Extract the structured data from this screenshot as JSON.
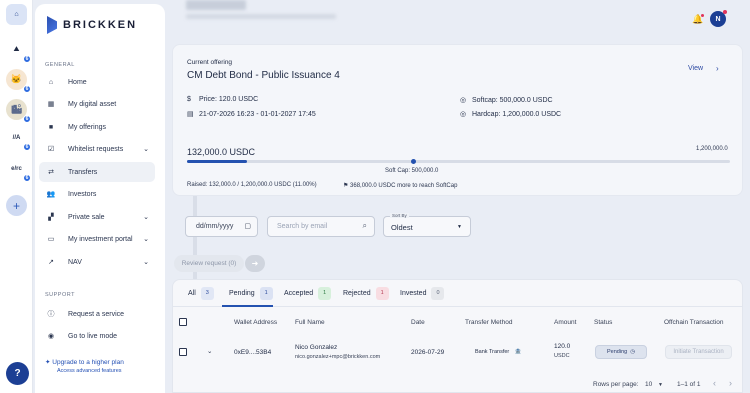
{
  "rail": {
    "home_icon": "home-icon",
    "entities": [
      {
        "glyph": "⯅",
        "badge": "6",
        "color": "#1f2a44",
        "bg": "#ffffff"
      },
      {
        "glyph": "🐱",
        "badge": "6",
        "color": "#b26b2a",
        "bg": "#f6e6d2"
      },
      {
        "glyph": "🏙",
        "badge": "6",
        "color": "#5b6a8c",
        "bg": "#e8e2cf"
      },
      {
        "glyph": "//A",
        "badge": "6",
        "color": "#1f2a44",
        "bg": "#ffffff"
      },
      {
        "glyph": "e/rc",
        "badge": "6",
        "color": "#2b3650",
        "bg": "#ffffff"
      }
    ],
    "add_label": "+",
    "help_label": "?"
  },
  "sidebar": {
    "brand": "BRICKKEN",
    "general_label": "GENERAL",
    "items": [
      {
        "label": "Home",
        "icon": "home-icon",
        "glyph": "⌂",
        "chev": ""
      },
      {
        "label": "My digital asset",
        "icon": "building-icon",
        "glyph": "▦",
        "chev": ""
      },
      {
        "label": "My offerings",
        "icon": "briefcase-icon",
        "glyph": "■",
        "chev": ""
      },
      {
        "label": "Whitelist requests",
        "icon": "checkbox-icon",
        "glyph": "☑",
        "chev": "⌄"
      },
      {
        "label": "Transfers",
        "icon": "transfer-icon",
        "glyph": "⇄",
        "chev": ""
      },
      {
        "label": "Investors",
        "icon": "people-icon",
        "glyph": "👥",
        "chev": ""
      },
      {
        "label": "Private sale",
        "icon": "grid-icon",
        "glyph": "▞",
        "chev": "⌄"
      },
      {
        "label": "My investment portal",
        "icon": "portal-icon",
        "glyph": "▭",
        "chev": "⌄"
      },
      {
        "label": "NAV",
        "icon": "trend-icon",
        "glyph": "↗",
        "chev": "⌄"
      }
    ],
    "support_label": "SUPPORT",
    "support_items": [
      {
        "label": "Request a service",
        "icon": "info-icon",
        "glyph": "ⓘ"
      },
      {
        "label": "Go to live mode",
        "icon": "broadcast-icon",
        "glyph": "◉"
      }
    ],
    "upgrade_title": "Upgrade to a higher plan",
    "upgrade_sub": "Access advanced features"
  },
  "header": {
    "avatar_initial": "N"
  },
  "offering": {
    "current_label": "Current offering",
    "title": "CM Debt Bond - Public Issuance 4",
    "view_label": "View",
    "price": "Price: 120.0 USDC",
    "dates": "21-07-2026 16:23 - 01-01-2027 17:45",
    "softcap": "Softcap: 500,000.0 USDC",
    "hardcap": "Hardcap: 1,200,000.0 USDC",
    "amount_raised": "132,000.0 USDC",
    "hardcap_short": "1,200,000.0",
    "softcap_marker": "Soft Cap: 500,000.0",
    "raised_text": "Raised:  132,000.0 / 1,200,000.0 USDC (11.00%)",
    "more_text": "368,000.0 USDC more to reach SoftCap",
    "progress_fraction": 0.11,
    "softcap_fraction": 0.4167
  },
  "filters": {
    "date_placeholder": "dd/mm/yyyy",
    "search_placeholder": "Search by email",
    "sort_caption": "Sort By",
    "sort_value": "Oldest",
    "review_label": "Review request (0)",
    "review_go": "➜"
  },
  "tabs": [
    {
      "label": "All",
      "count": "3",
      "bg": "#e1e7f5",
      "fg": "#2b4a9c"
    },
    {
      "label": "Pending",
      "count": "1",
      "bg": "#dbe2f3",
      "fg": "#2b4a9c"
    },
    {
      "label": "Accepted",
      "count": "1",
      "bg": "#d7f0dc",
      "fg": "#2e7a43"
    },
    {
      "label": "Rejected",
      "count": "1",
      "bg": "#f8dde2",
      "fg": "#b33a52"
    },
    {
      "label": "Invested",
      "count": "0",
      "bg": "#e6e8ec",
      "fg": "#5b6478"
    }
  ],
  "table": {
    "columns": [
      "Wallet Address",
      "Full Name",
      "Date",
      "Transfer Method",
      "Amount",
      "Status",
      "Offchain Transaction"
    ],
    "rows": [
      {
        "wallet": "0xE9....53B4",
        "name": "Nico Gonzalez",
        "email": "nico.gonzalez+mpc@brickken.com",
        "date": "2026-07-29",
        "method": "Bank Transfer",
        "amount": "120.0",
        "currency": "USDC",
        "status": "Pending",
        "action": "Initiate Transaction"
      }
    ]
  },
  "pagination": {
    "rows_label": "Rows per page:",
    "rows_value": "10",
    "range": "1–1 of 1"
  }
}
